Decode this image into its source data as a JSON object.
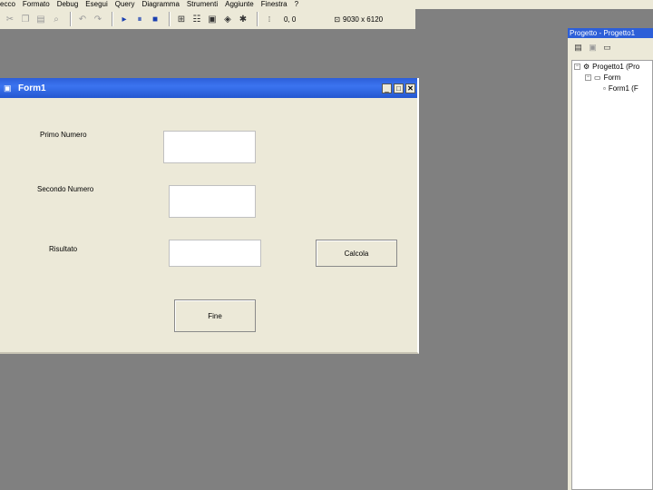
{
  "menu": [
    "ecco",
    "Formato",
    "Debug",
    "Esegui",
    "Query",
    "Diagramma",
    "Strumenti",
    "Aggiunte",
    "Finestra",
    "?"
  ],
  "toolbar": {
    "icons": [
      "cut-icon",
      "copy-icon",
      "paste-icon",
      "find-icon",
      "undo-icon",
      "redo-icon",
      "run-icon",
      "pause-icon",
      "stop-icon",
      "project-explorer-icon",
      "properties-icon",
      "form-layout-icon",
      "object-browser-icon",
      "toolbox-icon"
    ],
    "coords": "0, 0",
    "size": "9030 x 6120"
  },
  "form": {
    "title": "Form1",
    "label1": "Primo Numero",
    "label2": "Secondo Numero",
    "label3": "Risultato",
    "calc_button": "Calcola",
    "end_button": "Fine"
  },
  "project": {
    "title": "Progetto - Progetto1",
    "root": "Progetto1 (Pro",
    "folder": "Form",
    "item": "Form1 (F"
  }
}
